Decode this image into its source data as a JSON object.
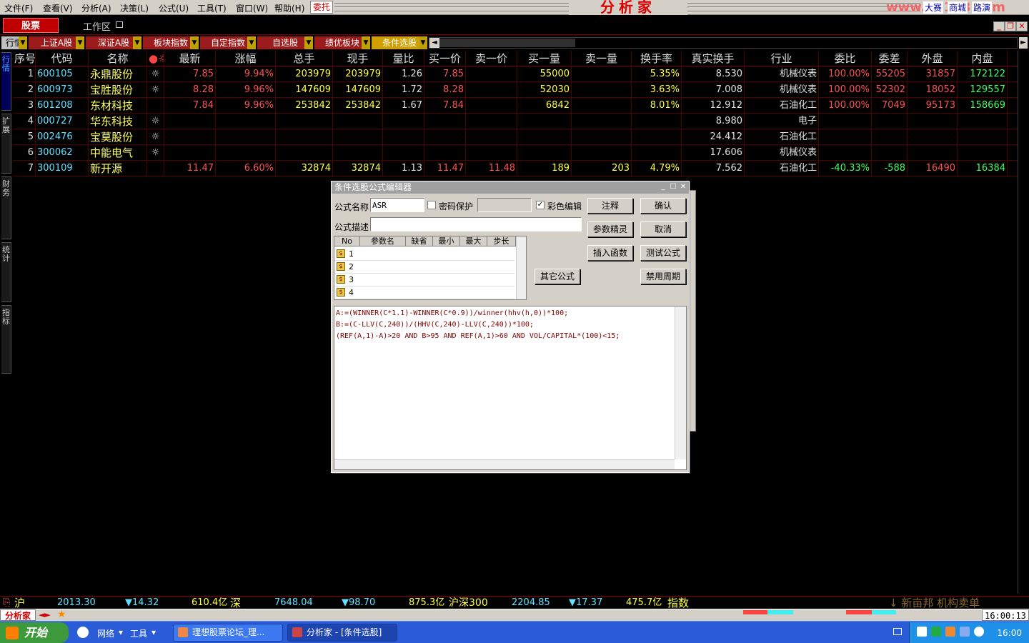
{
  "menu": [
    "文件(F)",
    "查看(V)",
    "分析(A)",
    "决策(L)",
    "公式(U)",
    "工具(T)",
    "窗口(W)",
    "帮助(H)"
  ],
  "weituo": "委托",
  "brand": "分析家",
  "brand_site": "www.55188.com",
  "top_links": [
    "大赛",
    "商城",
    "路演"
  ],
  "tabs2": {
    "stock": "股票",
    "workspace": "工作区"
  },
  "tabs3": [
    "行情",
    "上证A股",
    "深证A股",
    "板块指数",
    "自定指数",
    "自选股",
    "绩优板块",
    "条件选股"
  ],
  "side_tabs": [
    "行情",
    "扩展",
    "财务",
    "统计",
    "指标"
  ],
  "table": {
    "headers": [
      "序号",
      "代码",
      "名称",
      "●☼",
      "最新",
      "涨幅",
      "总手",
      "现手",
      "量比",
      "买一价",
      "卖一价",
      "买一量",
      "卖一量",
      "换手率",
      "真实换手",
      "行业",
      "委比",
      "委差",
      "外盘",
      "内盘"
    ],
    "rows": [
      {
        "no": "1",
        "code": "600105",
        "name": "永鼎股份",
        "flag": "☼",
        "last": "7.85",
        "chg": "9.94%",
        "vol": "203979",
        "cur": "203979",
        "ratio": "1.26",
        "bid": "7.85",
        "ask": "",
        "bidv": "55000",
        "askv": "",
        "turn": "5.35%",
        "realturn": "8.530",
        "ind": "机械仪表",
        "wb": "100.00%",
        "wc": "55205",
        "out": "31857",
        "in": "172122"
      },
      {
        "no": "2",
        "code": "600973",
        "name": "宝胜股份",
        "flag": "☼",
        "last": "8.28",
        "chg": "9.96%",
        "vol": "147609",
        "cur": "147609",
        "ratio": "1.72",
        "bid": "8.28",
        "ask": "",
        "bidv": "52030",
        "askv": "",
        "turn": "3.63%",
        "realturn": "7.008",
        "ind": "机械仪表",
        "wb": "100.00%",
        "wc": "52302",
        "out": "18052",
        "in": "129557"
      },
      {
        "no": "3",
        "code": "601208",
        "name": "东材科技",
        "flag": "",
        "last": "7.84",
        "chg": "9.96%",
        "vol": "253842",
        "cur": "253842",
        "ratio": "1.67",
        "bid": "7.84",
        "ask": "",
        "bidv": "6842",
        "askv": "",
        "turn": "8.01%",
        "realturn": "12.912",
        "ind": "石油化工",
        "wb": "100.00%",
        "wc": "7049",
        "out": "95173",
        "in": "158669"
      },
      {
        "no": "4",
        "code": "000727",
        "name": "华东科技",
        "flag": "☼",
        "last": "",
        "chg": "",
        "vol": "",
        "cur": "",
        "ratio": "",
        "bid": "",
        "ask": "",
        "bidv": "",
        "askv": "",
        "turn": "",
        "realturn": "8.980",
        "ind": "电子",
        "wb": "",
        "wc": "",
        "out": "",
        "in": ""
      },
      {
        "no": "5",
        "code": "002476",
        "name": "宝莫股份",
        "flag": "☼",
        "last": "",
        "chg": "",
        "vol": "",
        "cur": "",
        "ratio": "",
        "bid": "",
        "ask": "",
        "bidv": "",
        "askv": "",
        "turn": "",
        "realturn": "24.412",
        "ind": "石油化工",
        "wb": "",
        "wc": "",
        "out": "",
        "in": ""
      },
      {
        "no": "6",
        "code": "300062",
        "name": "中能电气",
        "flag": "☼",
        "last": "",
        "chg": "",
        "vol": "",
        "cur": "",
        "ratio": "",
        "bid": "",
        "ask": "",
        "bidv": "",
        "askv": "",
        "turn": "",
        "realturn": "17.606",
        "ind": "机械仪表",
        "wb": "",
        "wc": "",
        "out": "",
        "in": ""
      },
      {
        "no": "7",
        "code": "300109",
        "name": "新开源",
        "flag": "",
        "last": "11.47",
        "chg": "6.60%",
        "vol": "32874",
        "cur": "32874",
        "ratio": "1.13",
        "bid": "11.47",
        "ask": "11.48",
        "bidv": "189",
        "askv": "203",
        "turn": "4.79%",
        "realturn": "7.562",
        "ind": "石油化工",
        "wb": "-40.33%",
        "wc": "-588",
        "out": "16490",
        "in": "16384"
      }
    ]
  },
  "dialog": {
    "title": "条件选股公式编辑器",
    "name_label": "公式名称",
    "name_value": "ASR",
    "password_label": "密码保护",
    "color_edit_label": "彩色编辑",
    "desc_label": "公式描述",
    "param_headers": [
      "No",
      "参数名",
      "缺省",
      "最小",
      "最大",
      "步长"
    ],
    "param_rows": [
      "1",
      "2",
      "3",
      "4"
    ],
    "buttons": {
      "comment": "注释",
      "confirm": "确认",
      "param_wizard": "参数精灵",
      "cancel": "取消",
      "insert_func": "插入函数",
      "test": "测试公式",
      "other": "其它公式",
      "disable_period": "禁用周期"
    },
    "code": [
      "A:=(WINNER(C*1.1)-WINNER(C*0.9))/winner(hhv(h,0))*100;",
      "B:=(C-LLV(C,240))/(HHV(C,240)-LLV(C,240))*100;",
      "(REF(A,1)-A)>20 AND B>95 AND REF(A,1)>60 AND VOL/CAPITAL*(100)<15;"
    ]
  },
  "index_bar": {
    "sh_label": "沪",
    "sh_val": "2013.30",
    "sh_chg": "▼14.32",
    "sh_amt": "610.4亿",
    "sz_label": "深",
    "sz_val": "7648.04",
    "sz_chg": "▼98.70",
    "sz_amt": "875.3亿",
    "hs_label": "沪深300",
    "hs_val": "2204.85",
    "hs_chg": "▼17.37",
    "hs_amt": "475.7亿",
    "idx_label": "指数",
    "news": "↓ 新亩邦  机构卖单"
  },
  "status": {
    "logo": "分析家",
    "clock": "16:00:13"
  },
  "taskbar": {
    "start": "开始",
    "items": [
      "网络",
      "工具"
    ],
    "tasks": [
      "理想股票论坛_理...",
      "分析家 - [条件选股]"
    ],
    "time": "16:00"
  },
  "colors": {
    "accent": "#c00000",
    "up": "#ff5050",
    "yellow": "#ffff40",
    "cyan": "#60e0ff"
  }
}
